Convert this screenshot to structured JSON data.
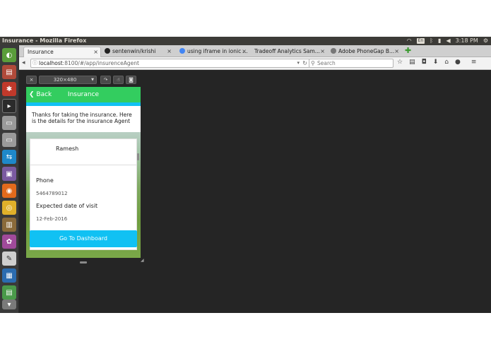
{
  "window": {
    "title": "Insurance - Mozilla Firefox"
  },
  "tray": {
    "lang": "En",
    "time": "3:18 PM"
  },
  "tabs": [
    {
      "label": "Insurance",
      "active": true
    },
    {
      "label": "sentenwin/krishi",
      "active": false
    },
    {
      "label": "using iframe in ionic ...",
      "active": false
    },
    {
      "label": "Tradeoff Analytics Sam...",
      "active": false
    },
    {
      "label": "Adobe PhoneGap B...",
      "active": false
    }
  ],
  "navbar": {
    "url_host": "localhost",
    "url_rest": ":8100/#/app/insurenceAgent",
    "search_placeholder": "Search"
  },
  "rdm": {
    "close": "×",
    "size": "320×480",
    "rotate": "↷",
    "touch": "☝",
    "screenshot": "◙"
  },
  "app": {
    "back_label": "Back",
    "title": "Insurance",
    "intro": "Thanks for taking the insurance. Here is the details for the insurance Agent",
    "agent_name": "Ramesh",
    "phone_label": "Phone",
    "phone_value": "5464789012",
    "visit_label": "Expected date of visit",
    "visit_value": "12-Feb-2016",
    "dashboard_button": "Go To Dashboard"
  },
  "colors": {
    "header_green": "#33cd5f",
    "accent_blue": "#11c1f3"
  }
}
